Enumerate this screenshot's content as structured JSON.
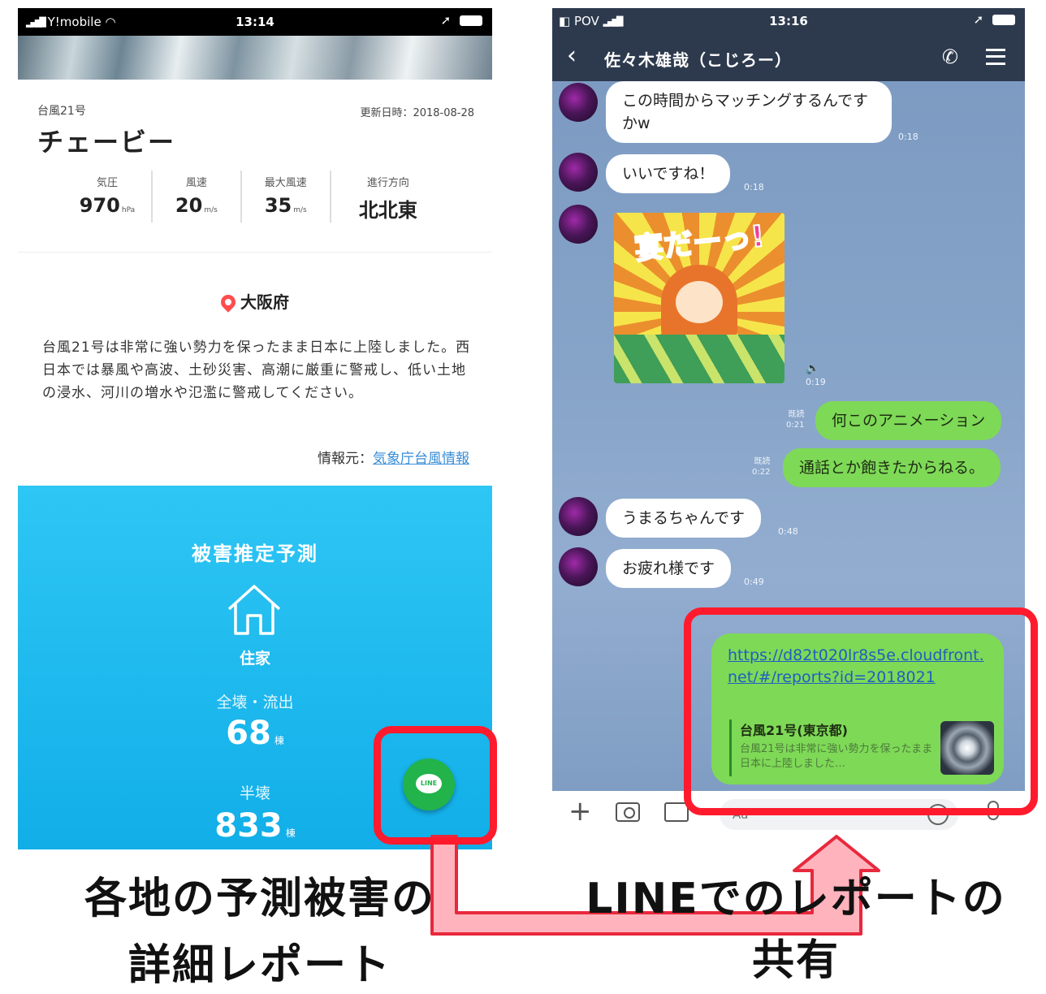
{
  "left_phone": {
    "status": {
      "carrier": "Y!mobile",
      "time": "13:14"
    },
    "typhoon_number": "台風21号",
    "updated": "更新日時：2018-08-28",
    "typhoon_name": "チェービー",
    "stats": [
      {
        "label": "気圧",
        "value": "970",
        "unit": "hPa"
      },
      {
        "label": "風速",
        "value": "20",
        "unit": "m/s"
      },
      {
        "label": "最大風速",
        "value": "35",
        "unit": "m/s"
      },
      {
        "label": "進行方向",
        "value": "北北東",
        "unit": ""
      }
    ],
    "location": "大阪府",
    "description": "台風21号は非常に強い勢力を保ったまま日本に上陸しました。西日本では暴風や高波、土砂災害、高潮に厳重に警戒し、低い土地の浸水、河川の増水や氾濫に警戒してください。",
    "source_label": "情報元：",
    "source_link": "気象庁台風情報",
    "estimate": {
      "title": "被害推定予測",
      "category": "住家",
      "label1": "全壊・流出",
      "value1": "68",
      "unit1": "棟",
      "label2": "半壊",
      "value2": "833",
      "unit2": "棟"
    },
    "line_button": "LINE",
    "colors": {
      "panel": "#11aee8",
      "line_green": "#22b34b"
    }
  },
  "right_phone": {
    "status": {
      "carrier": "POV",
      "time": "13:16"
    },
    "chat_title": "佐々木雄哉（こじろー）",
    "messages": [
      {
        "text": "この時間からマッチングするんですかw",
        "time": "0:18"
      },
      {
        "text": "いいですね！",
        "time": "0:18"
      },
      {
        "sticker_text": "宴だーっ!",
        "time": "0:19"
      },
      {
        "text": "何このアニメーション",
        "time": "0:21",
        "read": "既読"
      },
      {
        "text": "通話とか飽きたからねる。",
        "time": "0:22",
        "read": "既読"
      },
      {
        "text": "うまるちゃんです",
        "time": "0:48"
      },
      {
        "text": "お疲れ様です",
        "time": "0:49"
      }
    ],
    "shared": {
      "url": "https://d82t020lr8s5e.cloudfront.net/#/reports?id=2018021",
      "preview_title": "台風21号(東京都)",
      "preview_text": "台風21号は非常に強い勢力を保ったまま日本に上陸しました…"
    },
    "input_placeholder": "Aa",
    "colors": {
      "header": "#2d3a4e",
      "bubble_out": "#7ed957"
    }
  },
  "annotations": {
    "caption_left_1": "各地の予測被害の",
    "caption_left_2": "詳細レポート",
    "caption_right_1": "LINEでのレポートの",
    "caption_right_2": "共有",
    "frame_color": "#ff1b2d"
  }
}
